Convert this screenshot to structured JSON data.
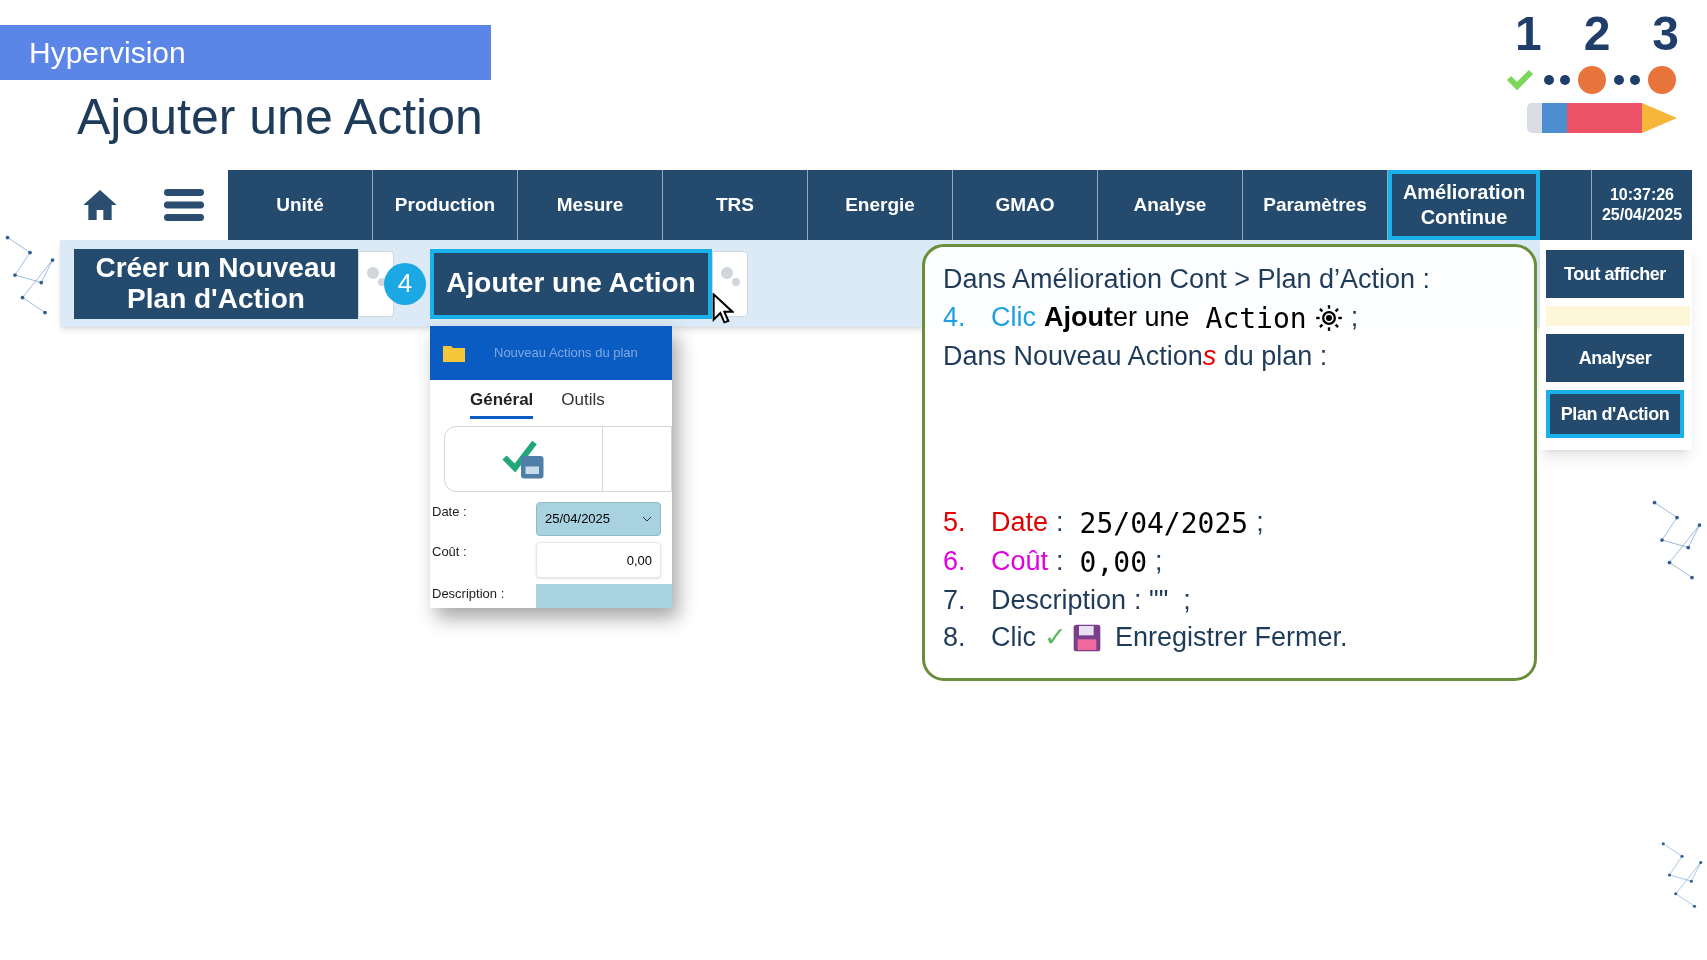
{
  "section_banner": "Hypervision",
  "title": "Ajouter une Action",
  "logo": {
    "digits": [
      "1",
      "2",
      "3"
    ]
  },
  "nav": {
    "tabs": [
      {
        "kind": "tab",
        "label": "Unité",
        "selected": false
      },
      {
        "kind": "tab",
        "label": "Production",
        "selected": false
      },
      {
        "kind": "tab",
        "label": "Mesure",
        "selected": false
      },
      {
        "kind": "tab",
        "label": "TRS",
        "selected": false
      },
      {
        "kind": "tab",
        "label": "Energie",
        "selected": false
      },
      {
        "kind": "tab",
        "label": "GMAO",
        "selected": false
      },
      {
        "kind": "tab",
        "label": "Analyse",
        "selected": false
      },
      {
        "kind": "tab",
        "label": "Paramètres",
        "selected": false
      },
      {
        "kind": "tab",
        "label": "Amélioration Continue",
        "selected": true
      }
    ],
    "clock": {
      "time": "10:37:26",
      "date": "25/04/2025"
    }
  },
  "toolbar": {
    "buttons": [
      {
        "label": "Créer un Nouveau Plan d'Action",
        "highlighted": false
      },
      {
        "label": "Ajouter une Action",
        "highlighted": true,
        "step_badge": "4"
      }
    ]
  },
  "side_buttons": [
    {
      "label": "Tout afficher",
      "selected": false
    },
    {
      "label": "Analyser",
      "selected": false
    },
    {
      "label": "Plan d'Action",
      "selected": true
    }
  ],
  "dialog": {
    "title": "Nouveau Actions du plan",
    "tabs": [
      {
        "label": "Général",
        "selected": true
      },
      {
        "label": "Outils",
        "selected": false
      }
    ],
    "fields": [
      {
        "kind": "date",
        "label": "Date :",
        "value": "25/04/2025"
      },
      {
        "kind": "number",
        "label": "Coût :",
        "value": "0,00"
      },
      {
        "kind": "text",
        "label": "Description :"
      }
    ]
  },
  "instructions": [
    {
      "kind": "heading",
      "text": "Dans Amélioration Cont > Plan d’Action :"
    },
    {
      "kind": "step",
      "number": "4.",
      "color": "#1ba1e2",
      "lead": "Clic",
      "segments": [
        {
          "kind": "text",
          "text": "**Ajout**er une"
        },
        {
          "kind": "mono",
          "text": "Action"
        },
        {
          "kind": "gear"
        },
        {
          "kind": "plain",
          "text": ";"
        }
      ]
    },
    {
      "kind": "heading",
      "parts": [
        {
          "kind": "plain",
          "text": "Dans Nouveau Action"
        },
        {
          "kind": "accent",
          "text": "s"
        },
        {
          "kind": "plain",
          "text": " du plan :"
        }
      ]
    },
    {
      "kind": "spacer"
    },
    {
      "kind": "step",
      "number": "5.",
      "color": "#e00000",
      "lead": "Date",
      "segments": [
        {
          "kind": "plain",
          "text": ":"
        },
        {
          "kind": "mono",
          "text": "25/04/2025"
        },
        {
          "kind": "plain",
          "text": ";"
        }
      ]
    },
    {
      "kind": "step",
      "number": "6.",
      "color": "#e000e0",
      "lead": "Coût",
      "segments": [
        {
          "kind": "plain",
          "text": ":"
        },
        {
          "kind": "mono",
          "text": "0,00"
        },
        {
          "kind": "plain",
          "text": ";"
        }
      ]
    },
    {
      "kind": "step",
      "number": "7.",
      "color": "#1f3b5a",
      "lead": "Description",
      "segments": [
        {
          "kind": "plain",
          "text": ": \"\"  ;"
        }
      ]
    },
    {
      "kind": "step",
      "number": "8.",
      "color": "#1f3b5a",
      "lead": "Clic",
      "segments": [
        {
          "kind": "check",
          "text": "✓"
        },
        {
          "kind": "floppy"
        },
        {
          "kind": "plain",
          "text": "Enregistrer Fermer."
        }
      ]
    }
  ]
}
